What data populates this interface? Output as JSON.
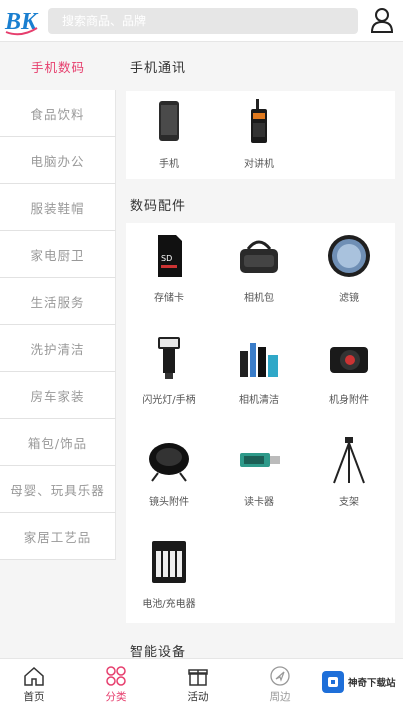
{
  "header": {
    "logo_text": "BK",
    "search_placeholder": "搜索商品、品牌",
    "user_icon": "user-icon"
  },
  "sidebar": {
    "items": [
      {
        "label": "手机数码",
        "active": true
      },
      {
        "label": "食品饮料",
        "active": false
      },
      {
        "label": "电脑办公",
        "active": false
      },
      {
        "label": "服装鞋帽",
        "active": false
      },
      {
        "label": "家电厨卫",
        "active": false
      },
      {
        "label": "生活服务",
        "active": false
      },
      {
        "label": "洗护清洁",
        "active": false
      },
      {
        "label": "房车家装",
        "active": false
      },
      {
        "label": "箱包/饰品",
        "active": false
      },
      {
        "label": "母婴、玩具乐器",
        "active": false
      },
      {
        "label": "家居工艺品",
        "active": false
      }
    ]
  },
  "sections": [
    {
      "title": "手机通讯",
      "products": [
        {
          "label": "手机",
          "icon": "smartphone-icon"
        },
        {
          "label": "对讲机",
          "icon": "walkie-talkie-icon"
        }
      ]
    },
    {
      "title": "数码配件",
      "products": [
        {
          "label": "存储卡",
          "icon": "memory-card-icon"
        },
        {
          "label": "相机包",
          "icon": "camera-bag-icon"
        },
        {
          "label": "滤镜",
          "icon": "lens-filter-icon"
        },
        {
          "label": "闪光灯/手柄",
          "icon": "flash-icon"
        },
        {
          "label": "相机清洁",
          "icon": "camera-cleaning-icon"
        },
        {
          "label": "机身附件",
          "icon": "camera-body-icon"
        },
        {
          "label": "镜头附件",
          "icon": "lens-cap-icon"
        },
        {
          "label": "读卡器",
          "icon": "card-reader-icon"
        },
        {
          "label": "支架",
          "icon": "tripod-icon"
        },
        {
          "label": "电池/充电器",
          "icon": "battery-icon"
        }
      ]
    },
    {
      "title": "智能设备",
      "products": []
    }
  ],
  "tabbar": {
    "tabs": [
      {
        "label": "首页",
        "icon": "home-icon",
        "active": false
      },
      {
        "label": "分类",
        "icon": "category-icon",
        "active": true
      },
      {
        "label": "活动",
        "icon": "gift-icon",
        "active": false
      },
      {
        "label": "周边",
        "icon": "navigation-icon",
        "active": false
      }
    ],
    "brand_text": "神奇下载站"
  },
  "colors": {
    "accent": "#e63e6d",
    "background": "#f5f5f5",
    "brand_blue": "#1e6fd9"
  }
}
